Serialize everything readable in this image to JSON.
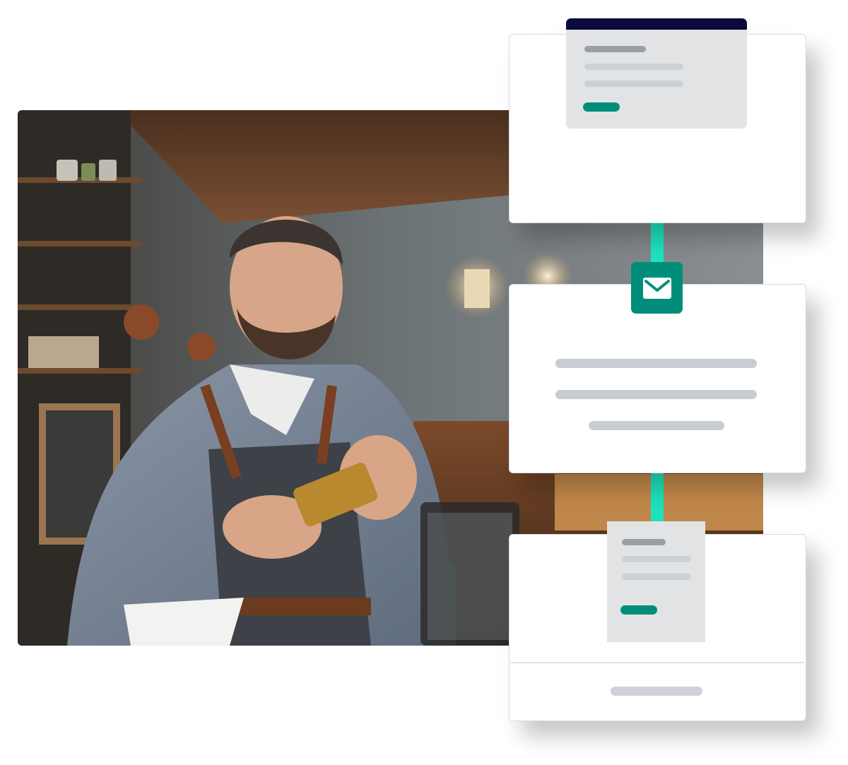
{
  "photo": {
    "subject": "barista-smartphone-photo"
  },
  "accent_color": "#008e7a",
  "connector_color": "#1de2bd",
  "header_color": "#0a0a3d",
  "icons": {
    "badge": "envelope-icon"
  }
}
